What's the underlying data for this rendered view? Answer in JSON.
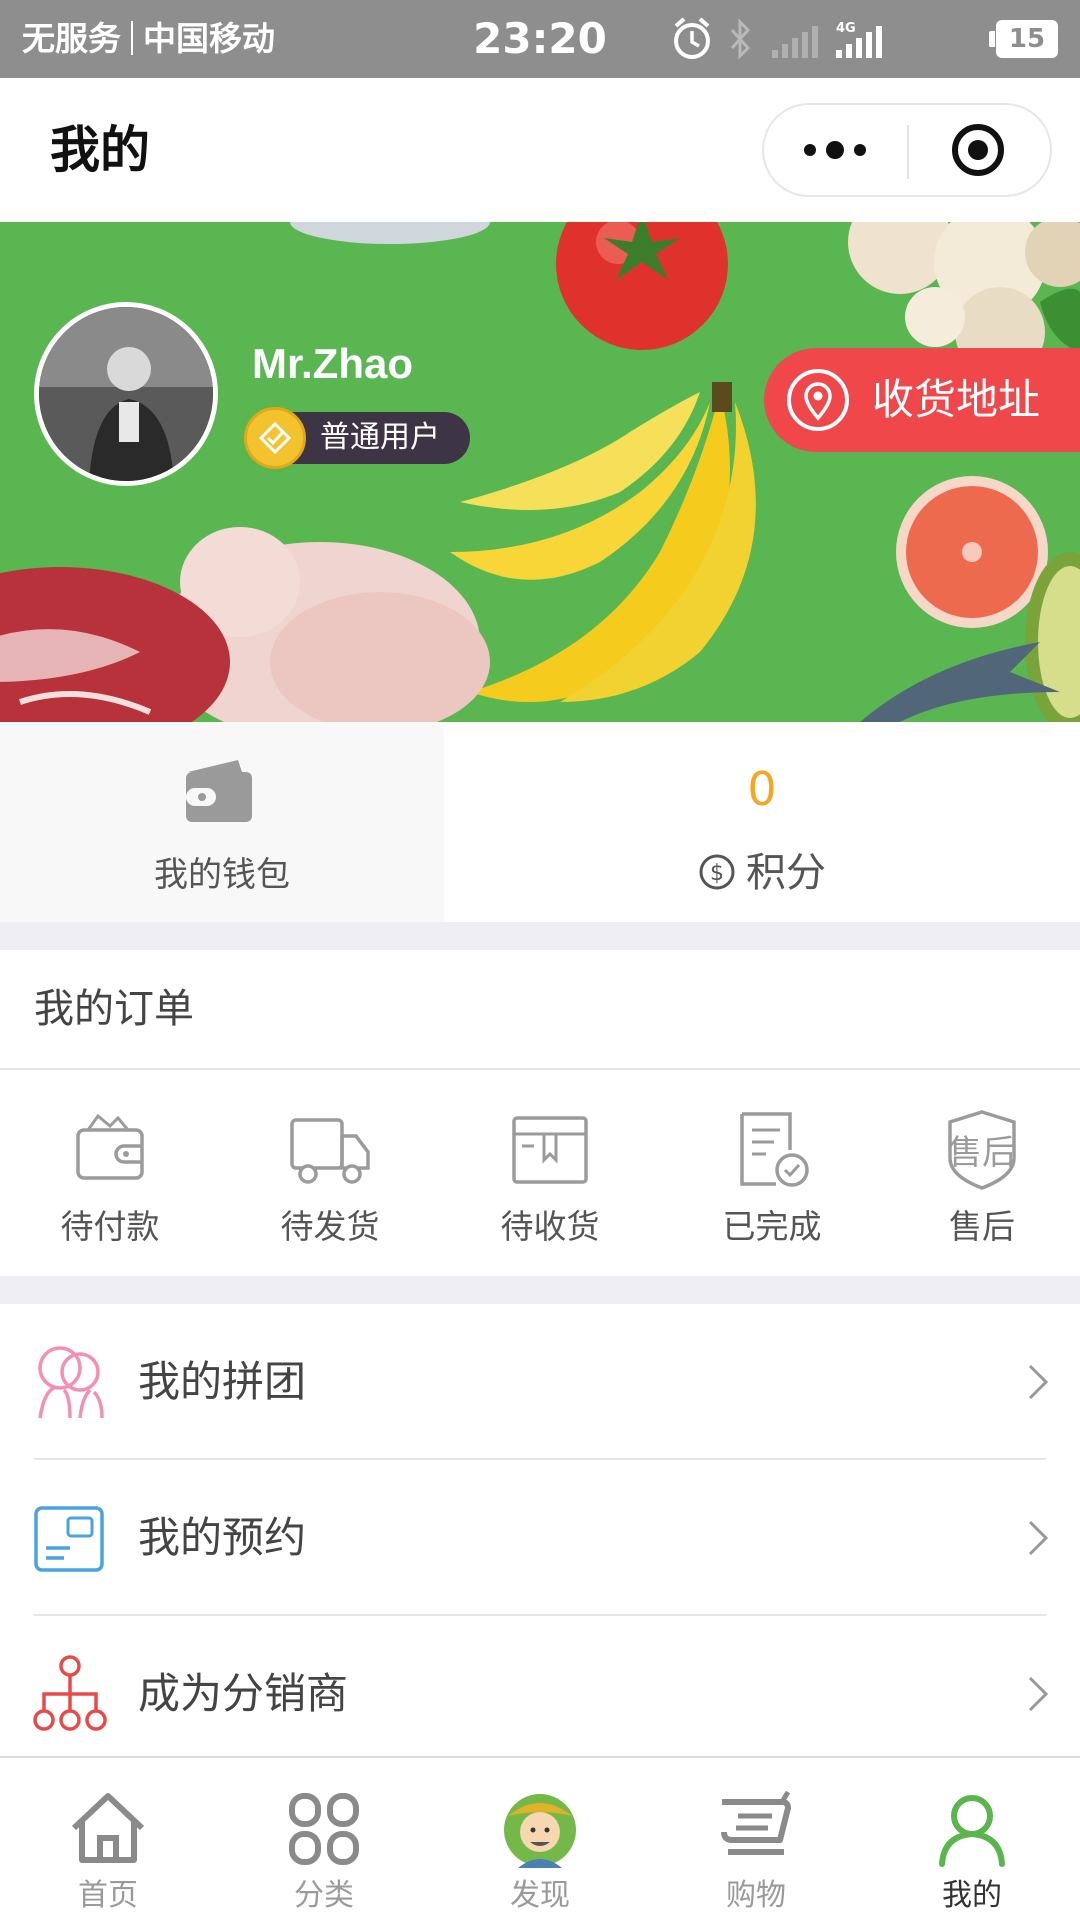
{
  "status_bar": {
    "service": "无服务",
    "carrier": "中国移动",
    "time": "23:20",
    "network": "4G",
    "battery": "15"
  },
  "nav": {
    "title": "我的"
  },
  "profile": {
    "username": "Mr.Zhao",
    "level": "普通用户",
    "address_button": "收货地址"
  },
  "assets": {
    "wallet_label": "我的钱包",
    "points_value": "0",
    "points_label": "积分"
  },
  "orders": {
    "title": "我的订单",
    "items": [
      {
        "label": "待付款",
        "icon": "wallet-icon"
      },
      {
        "label": "待发货",
        "icon": "truck-icon"
      },
      {
        "label": "待收货",
        "icon": "package-icon"
      },
      {
        "label": "已完成",
        "icon": "completed-doc-icon"
      },
      {
        "label": "售后",
        "icon": "after-sale-shield-icon"
      }
    ]
  },
  "menu": [
    {
      "label": "我的拼团",
      "icon": "group-buy-icon"
    },
    {
      "label": "我的预约",
      "icon": "reservation-card-icon"
    },
    {
      "label": "成为分销商",
      "icon": "distributor-tree-icon"
    }
  ],
  "tabbar": {
    "items": [
      {
        "label": "首页",
        "icon": "home-icon"
      },
      {
        "label": "分类",
        "icon": "category-grid-icon"
      },
      {
        "label": "发现",
        "icon": "farmer-avatar-icon"
      },
      {
        "label": "购物",
        "icon": "cart-icon"
      },
      {
        "label": "我的",
        "icon": "user-icon"
      }
    ],
    "active_index": 4
  },
  "colors": {
    "banner_green": "#59b651",
    "address_red": "#f0474b",
    "points_orange": "#f5a623",
    "tab_active_green": "#5ab54c",
    "status_bar_gray": "#8e8e8e"
  }
}
